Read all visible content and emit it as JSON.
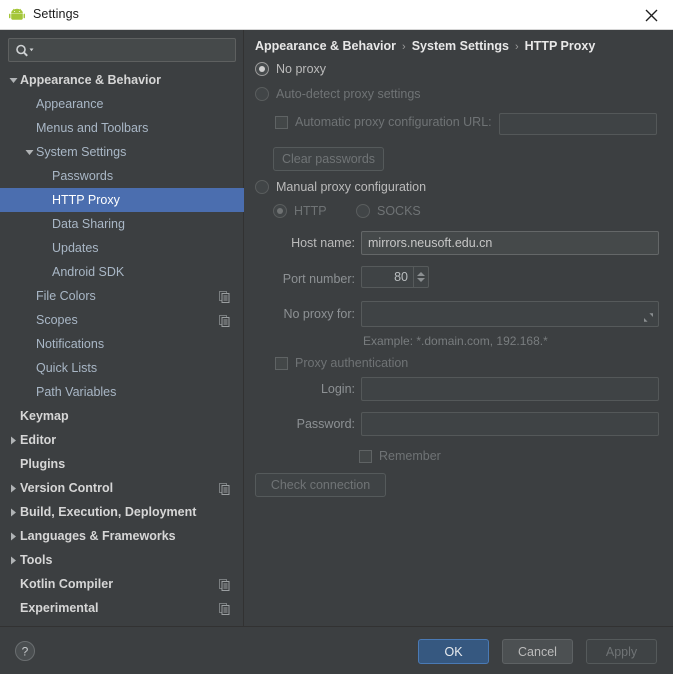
{
  "window": {
    "title": "Settings",
    "app_icon": "android-icon",
    "close_icon": "close-icon"
  },
  "sidebar": {
    "search": {
      "value": "",
      "placeholder": "",
      "icon": "search-icon"
    },
    "items": [
      {
        "label": "Appearance & Behavior",
        "level": 0,
        "arrow": "expanded",
        "selected": false,
        "copy": false
      },
      {
        "label": "Appearance",
        "level": 1,
        "arrow": "none",
        "selected": false,
        "copy": false
      },
      {
        "label": "Menus and Toolbars",
        "level": 1,
        "arrow": "none",
        "selected": false,
        "copy": false
      },
      {
        "label": "System Settings",
        "level": 1,
        "arrow": "expanded",
        "selected": false,
        "copy": false
      },
      {
        "label": "Passwords",
        "level": 2,
        "arrow": "none",
        "selected": false,
        "copy": false
      },
      {
        "label": "HTTP Proxy",
        "level": 2,
        "arrow": "none",
        "selected": true,
        "copy": false
      },
      {
        "label": "Data Sharing",
        "level": 2,
        "arrow": "none",
        "selected": false,
        "copy": false
      },
      {
        "label": "Updates",
        "level": 2,
        "arrow": "none",
        "selected": false,
        "copy": false
      },
      {
        "label": "Android SDK",
        "level": 2,
        "arrow": "none",
        "selected": false,
        "copy": false
      },
      {
        "label": "File Colors",
        "level": 1,
        "arrow": "none",
        "selected": false,
        "copy": true
      },
      {
        "label": "Scopes",
        "level": 1,
        "arrow": "none",
        "selected": false,
        "copy": true
      },
      {
        "label": "Notifications",
        "level": 1,
        "arrow": "none",
        "selected": false,
        "copy": false
      },
      {
        "label": "Quick Lists",
        "level": 1,
        "arrow": "none",
        "selected": false,
        "copy": false
      },
      {
        "label": "Path Variables",
        "level": 1,
        "arrow": "none",
        "selected": false,
        "copy": false
      },
      {
        "label": "Keymap",
        "level": 0,
        "arrow": "none",
        "selected": false,
        "copy": false
      },
      {
        "label": "Editor",
        "level": 0,
        "arrow": "collapsed",
        "selected": false,
        "copy": false
      },
      {
        "label": "Plugins",
        "level": 0,
        "arrow": "none",
        "selected": false,
        "copy": false
      },
      {
        "label": "Version Control",
        "level": 0,
        "arrow": "collapsed",
        "selected": false,
        "copy": true
      },
      {
        "label": "Build, Execution, Deployment",
        "level": 0,
        "arrow": "collapsed",
        "selected": false,
        "copy": false
      },
      {
        "label": "Languages & Frameworks",
        "level": 0,
        "arrow": "collapsed",
        "selected": false,
        "copy": false
      },
      {
        "label": "Tools",
        "level": 0,
        "arrow": "collapsed",
        "selected": false,
        "copy": false
      },
      {
        "label": "Kotlin Compiler",
        "level": 0,
        "arrow": "none",
        "selected": false,
        "copy": true
      },
      {
        "label": "Experimental",
        "level": 0,
        "arrow": "none",
        "selected": false,
        "copy": true
      }
    ]
  },
  "content": {
    "breadcrumb": [
      "Appearance & Behavior",
      "System Settings",
      "HTTP Proxy"
    ],
    "breadcrumb_separator": "›",
    "no_proxy": {
      "label": "No proxy",
      "selected": true
    },
    "auto_detect": {
      "label": "Auto-detect proxy settings",
      "selected": false
    },
    "auto_config_url": {
      "label": "Automatic proxy configuration URL:",
      "checked": false,
      "value": "",
      "enabled": false
    },
    "clear_passwords_label": "Clear passwords",
    "manual_proxy": {
      "label": "Manual proxy configuration",
      "selected": false
    },
    "http_radio": {
      "label": "HTTP",
      "selected": true
    },
    "socks_radio": {
      "label": "SOCKS",
      "selected": false
    },
    "host_name": {
      "label": "Host name:",
      "value": "mirrors.neusoft.edu.cn"
    },
    "port_number": {
      "label": "Port number:",
      "value": "80"
    },
    "no_proxy_for": {
      "label": "No proxy for:",
      "value": "",
      "expand_icon": "expand-icon"
    },
    "example_text": "Example: *.domain.com, 192.168.*",
    "proxy_auth": {
      "label": "Proxy authentication",
      "checked": false
    },
    "login": {
      "label": "Login:",
      "value": ""
    },
    "password": {
      "label": "Password:",
      "value": ""
    },
    "remember": {
      "label": "Remember",
      "checked": false
    },
    "check_connection_label": "Check connection"
  },
  "footer": {
    "help_icon": "help-icon",
    "ok_label": "OK",
    "cancel_label": "Cancel",
    "apply_label": "Apply"
  },
  "colors": {
    "background": "#3c3f41",
    "selection": "#4b6eaf",
    "primary_button": "#365880",
    "titlebar": "#ffffff",
    "text": "#bbbbbb",
    "text_disabled": "#6f7375"
  }
}
